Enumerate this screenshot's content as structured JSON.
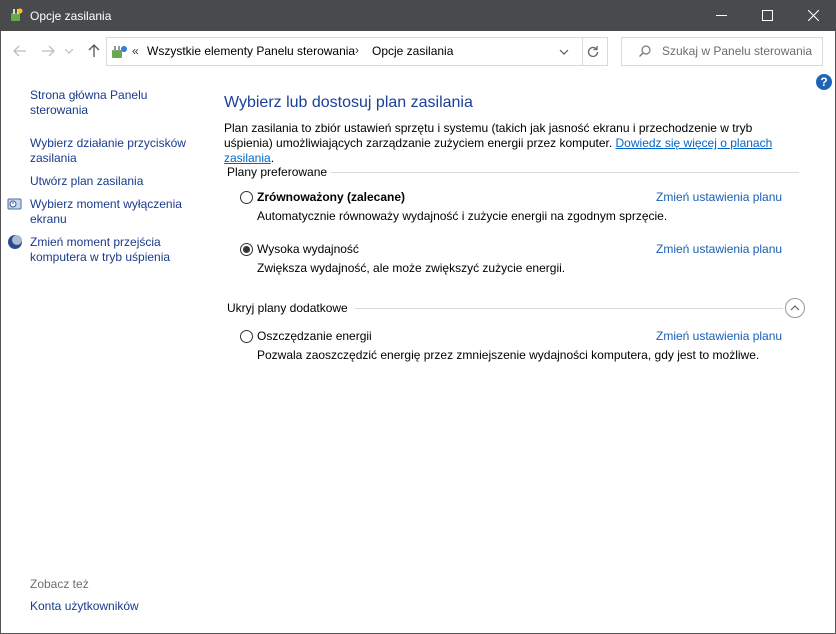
{
  "window": {
    "title": "Opcje zasilania"
  },
  "address": {
    "overflow_chevrons": "«",
    "crumbs": [
      "Wszystkie elementy Panelu sterowania",
      "Opcje zasilania"
    ],
    "separator": "›"
  },
  "search": {
    "placeholder": "Szukaj w Panelu sterowania"
  },
  "sidebar": {
    "items": [
      {
        "label": "Strona główna Panelu sterowania"
      },
      {
        "label": "Wybierz działanie przycisków zasilania"
      },
      {
        "label": "Utwórz plan zasilania"
      },
      {
        "label": "Wybierz moment wyłączenia ekranu"
      },
      {
        "label": "Zmień moment przejścia komputera w tryb uśpienia"
      }
    ],
    "see_also": "Zobacz też",
    "see_also_items": [
      {
        "label": "Konta użytkowników"
      }
    ]
  },
  "main": {
    "heading": "Wybierz lub dostosuj plan zasilania",
    "description": "Plan zasilania to zbiór ustawień sprzętu i systemu (takich jak jasność ekranu i przechodzenie w tryb uśpienia) umożliwiających zarządzanie zużyciem energii przez komputer. ",
    "description_link": "Dowiedz się więcej o planach zasilania",
    "description_end": ".",
    "preferred_group": "Plany preferowane",
    "additional_group": "Ukryj plany dodatkowe",
    "change_link": "Zmień ustawienia planu",
    "plans": [
      {
        "name": "Zrównoważony (zalecane)",
        "desc": "Automatycznie równoważy wydajność i zużycie energii na zgodnym sprzęcie.",
        "selected": false
      },
      {
        "name": "Wysoka wydajność",
        "desc": "Zwiększa wydajność, ale może zwiększyć zużycie energii.",
        "selected": true
      },
      {
        "name": "Oszczędzanie energii",
        "desc": "Pozwala zaoszczędzić energię przez zmniejszenie wydajności komputera, gdy jest to możliwe.",
        "selected": false
      }
    ]
  },
  "colors": {
    "titlebar": "#484a4c",
    "link": "#1a3a8c",
    "heading": "#1b3f99",
    "accent_link": "#1a5fb4"
  }
}
